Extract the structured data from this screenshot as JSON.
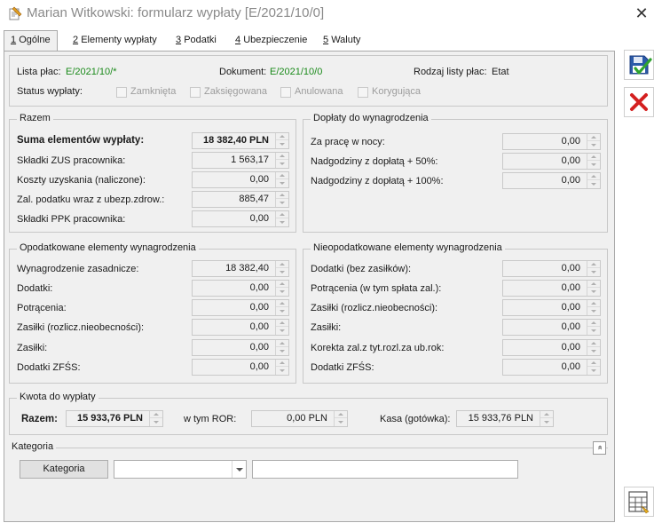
{
  "window": {
    "title": "Marian Witkowski: formularz wypłaty [E/2021/10/0]",
    "close_glyph": "✕"
  },
  "tabs": [
    {
      "key": "1",
      "label": "Ogólne"
    },
    {
      "key": "2",
      "label": "Elementy wypłaty"
    },
    {
      "key": "3",
      "label": "Podatki"
    },
    {
      "key": "4",
      "label": "Ubezpieczenie"
    },
    {
      "key": "5",
      "label": "Waluty"
    }
  ],
  "header": {
    "lista_plac_label": "Lista płac:",
    "lista_plac_value": "E/2021/10/*",
    "dokument_label": "Dokument:",
    "dokument_value": "E/2021/10/0",
    "rodzaj_label": "Rodzaj listy płac:",
    "rodzaj_value": "Etat",
    "status_label": "Status wypłaty:",
    "statuses": [
      "Zamknięta",
      "Zaksięgowana",
      "Anulowana",
      "Korygująca"
    ]
  },
  "razem": {
    "title": "Razem",
    "rows": [
      {
        "label": "Suma elementów wypłaty:",
        "value": "18 382,40 PLN"
      },
      {
        "label": "Składki ZUS pracownika:",
        "value": "1 563,17"
      },
      {
        "label": "Koszty uzyskania (naliczone):",
        "value": "0,00"
      },
      {
        "label": "Zal. podatku wraz z  ubezp.zdrow.:",
        "value": "885,47"
      },
      {
        "label": "Składki PPK pracownika:",
        "value": "0,00"
      }
    ]
  },
  "doplaty": {
    "title": "Dopłaty do wynagrodzenia",
    "rows": [
      {
        "label": "Za pracę w nocy:",
        "value": "0,00"
      },
      {
        "label": "Nadgodziny z dopłatą + 50%:",
        "value": "0,00"
      },
      {
        "label": "Nadgodziny z dopłatą + 100%:",
        "value": "0,00"
      }
    ]
  },
  "opodatkowane": {
    "title": "Opodatkowane elementy wynagrodzenia",
    "rows": [
      {
        "label": "Wynagrodzenie zasadnicze:",
        "value": "18 382,40"
      },
      {
        "label": "Dodatki:",
        "value": "0,00"
      },
      {
        "label": "Potrącenia:",
        "value": "0,00"
      },
      {
        "label": "Zasiłki (rozlicz.nieobecności):",
        "value": "0,00"
      },
      {
        "label": "Zasiłki:",
        "value": "0,00"
      },
      {
        "label": "Dodatki ZFŚS:",
        "value": "0,00"
      }
    ]
  },
  "nieopodatkowane": {
    "title": "Nieopodatkowane elementy wynagrodzenia",
    "rows": [
      {
        "label": "Dodatki (bez zasiłków):",
        "value": "0,00"
      },
      {
        "label": "Potrącenia (w tym spłata zal.):",
        "value": "0,00"
      },
      {
        "label": "Zasiłki (rozlicz.nieobecności):",
        "value": "0,00"
      },
      {
        "label": "Zasiłki:",
        "value": "0,00"
      },
      {
        "label": "Korekta zal.z tyt.rozl.za ub.rok:",
        "value": "0,00"
      },
      {
        "label": "Dodatki ZFŚS:",
        "value": "0,00"
      }
    ]
  },
  "kwota": {
    "title": "Kwota do wypłaty",
    "razem_label": "Razem:",
    "razem_value": "15 933,76 PLN",
    "ror_label": "w tym ROR:",
    "ror_value": "0,00 PLN",
    "kasa_label": "Kasa (gotówka):",
    "kasa_value": "15 933,76 PLN"
  },
  "kategoria": {
    "title": "Kategoria",
    "button_label": "Kategoria",
    "combo_value": "",
    "text_value": "",
    "collapse_glyph": "»"
  },
  "toolbar": {
    "save_icon": "save-check-icon",
    "cancel_icon": "red-x-icon",
    "calc_icon": "calculator-icon"
  }
}
